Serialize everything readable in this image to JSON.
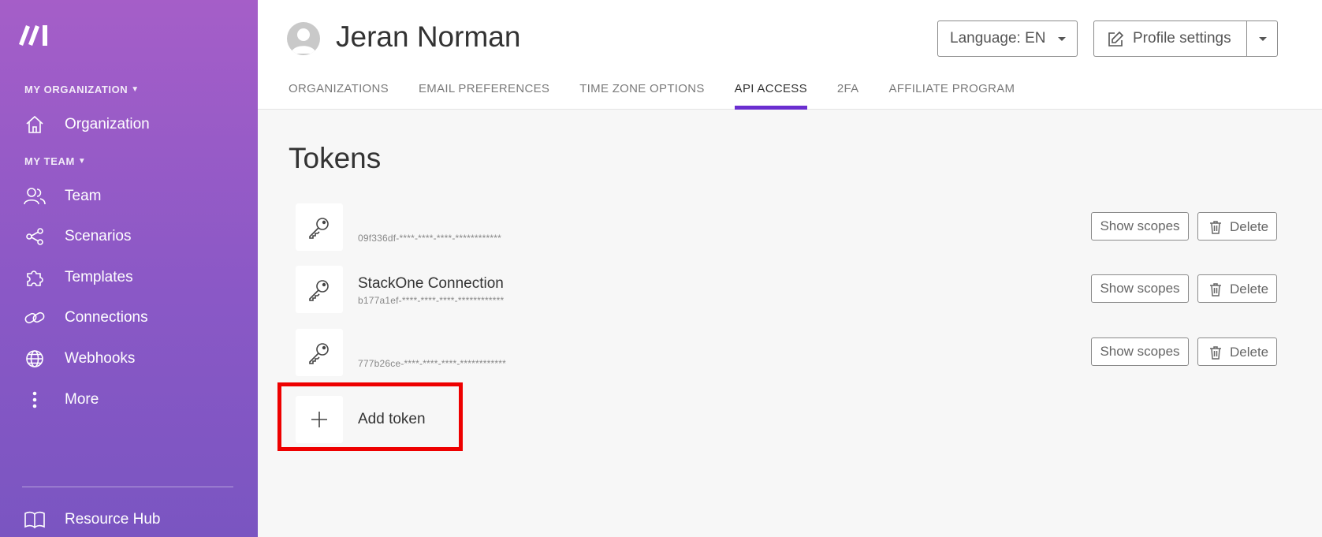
{
  "sidebar": {
    "org_section": "MY ORGANIZATION",
    "team_section": "MY TEAM",
    "items": [
      {
        "label": "Organization",
        "icon": "home-icon"
      },
      {
        "label": "Team",
        "icon": "team-icon"
      },
      {
        "label": "Scenarios",
        "icon": "share-icon"
      },
      {
        "label": "Templates",
        "icon": "puzzle-icon"
      },
      {
        "label": "Connections",
        "icon": "link-icon"
      },
      {
        "label": "Webhooks",
        "icon": "globe-icon"
      },
      {
        "label": "More",
        "icon": "more-vertical-icon"
      }
    ],
    "footer_item": {
      "label": "Resource Hub",
      "icon": "book-icon"
    }
  },
  "header": {
    "user_name": "Jeran Norman",
    "language_button": "Language: EN",
    "profile_button": "Profile settings",
    "tabs": [
      {
        "label": "ORGANIZATIONS"
      },
      {
        "label": "EMAIL PREFERENCES"
      },
      {
        "label": "TIME ZONE OPTIONS"
      },
      {
        "label": "API ACCESS"
      },
      {
        "label": "2FA"
      },
      {
        "label": "AFFILIATE PROGRAM"
      }
    ],
    "active_tab": "API ACCESS"
  },
  "main": {
    "title": "Tokens",
    "tokens": [
      {
        "name": "",
        "id": "09f336df-****-****-****-************",
        "scopes_label": "Show scopes",
        "delete_label": "Delete"
      },
      {
        "name": "StackOne Connection",
        "id": "b177a1ef-****-****-****-************",
        "scopes_label": "Show scopes",
        "delete_label": "Delete"
      },
      {
        "name": "",
        "id": "777b26ce-****-****-****-************",
        "scopes_label": "Show scopes",
        "delete_label": "Delete"
      }
    ],
    "add_token_label": "Add token"
  },
  "colors": {
    "sidebar_top": "#a55ec8",
    "sidebar_bottom": "#7a55c1",
    "active_tab_underline": "#6a2ed0",
    "highlight_border": "#ee0000"
  }
}
